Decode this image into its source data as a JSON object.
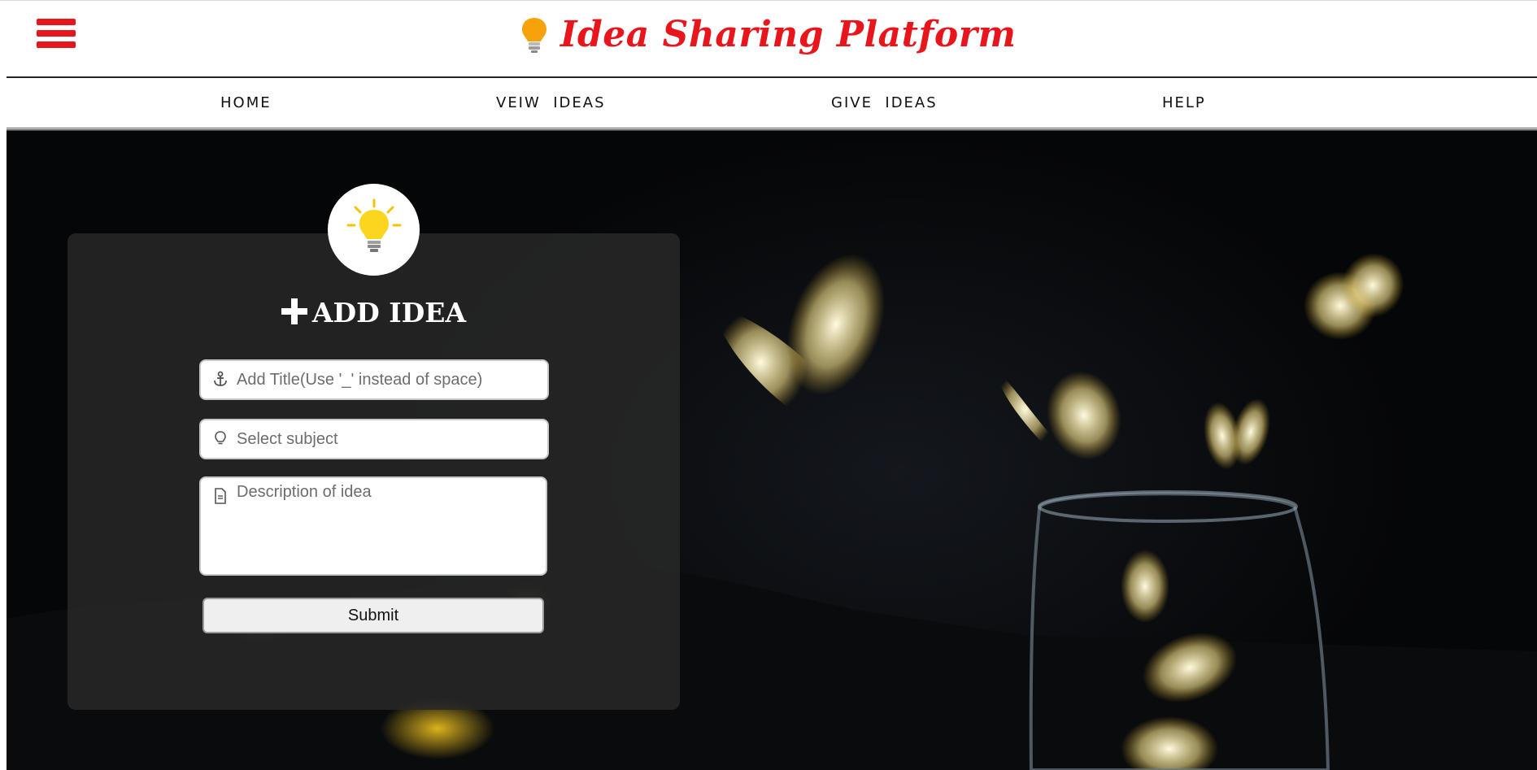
{
  "header": {
    "brand_title": "Idea Sharing Platform",
    "brand_color": "#e8161c",
    "menu_icon": "hamburger-menu-icon",
    "logo_icon": "lightbulb-icon"
  },
  "nav": {
    "items": [
      {
        "label": "HOME"
      },
      {
        "label": "VEIW  IDEAS"
      },
      {
        "label": "GIVE  IDEAS"
      },
      {
        "label": "HELP"
      }
    ]
  },
  "form": {
    "badge_icon": "glowing-lightbulb-icon",
    "title": "ADD IDEA",
    "title_icon": "plus-icon",
    "title_field": {
      "placeholder": "Add Title(Use '_' instead of space)",
      "value": "",
      "icon": "anchor-icon"
    },
    "subject_field": {
      "placeholder": "Select subject",
      "value": "",
      "icon": "lightbulb-outline-icon"
    },
    "description_field": {
      "placeholder": "Description of idea",
      "value": "",
      "icon": "document-icon"
    },
    "submit_label": "Submit"
  },
  "hero": {
    "background": "glowing-butterflies-jar-image"
  }
}
